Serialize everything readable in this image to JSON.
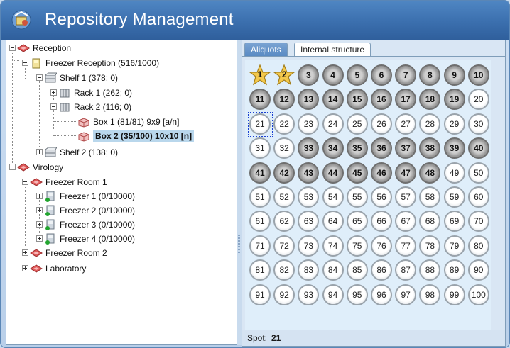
{
  "window": {
    "title": "Repository Management"
  },
  "tree": {
    "items": [
      {
        "label": "Reception",
        "icon": "storage-site-icon"
      },
      {
        "label": "Freezer Reception (516/1000)",
        "icon": "freezer-icon"
      },
      {
        "label": "Shelf 1 (378; 0)",
        "icon": "shelf-icon"
      },
      {
        "label": "Rack 1 (262; 0)",
        "icon": "rack-icon"
      },
      {
        "label": "Rack 2 (116; 0)",
        "icon": "rack-icon"
      },
      {
        "label": "Box 1 (81/81) 9x9 [a/n]",
        "icon": "box-icon"
      },
      {
        "label": "Box 2 (35/100) 10x10 [n]",
        "icon": "box-icon",
        "selected": true
      },
      {
        "label": "Shelf 2 (138; 0)",
        "icon": "shelf-icon"
      },
      {
        "label": "Virology",
        "icon": "storage-site-icon"
      },
      {
        "label": "Freezer Room 1",
        "icon": "storage-site-icon"
      },
      {
        "label": "Freezer 1 (0/10000)",
        "icon": "freezer-online-icon"
      },
      {
        "label": "Freezer 2 (0/10000)",
        "icon": "freezer-online-icon"
      },
      {
        "label": "Freezer 3 (0/10000)",
        "icon": "freezer-online-icon"
      },
      {
        "label": "Freezer 4 (0/10000)",
        "icon": "freezer-online-icon"
      },
      {
        "label": "Freezer Room 2",
        "icon": "storage-site-icon"
      },
      {
        "label": "Laboratory",
        "icon": "storage-site-icon"
      }
    ]
  },
  "tabs": [
    {
      "label": "Aliquots",
      "active": true
    },
    {
      "label": "Internal structure",
      "active": false
    }
  ],
  "box_grid": {
    "rows": 10,
    "cols": 10,
    "filled": [
      1,
      2,
      3,
      4,
      5,
      6,
      7,
      8,
      9,
      10,
      11,
      12,
      13,
      14,
      15,
      16,
      17,
      18,
      19,
      33,
      34,
      35,
      36,
      37,
      38,
      39,
      40,
      41,
      42,
      43,
      44,
      45,
      46,
      47,
      48
    ],
    "starred": [
      1,
      2
    ],
    "selected": 21
  },
  "status": {
    "label": "Spot:",
    "value": "21"
  },
  "colors": {
    "title_bar": "#3b6fae",
    "selection": "#b9d7ec",
    "filled_spot": "#9a9a9a",
    "star": "#f3c84b"
  }
}
